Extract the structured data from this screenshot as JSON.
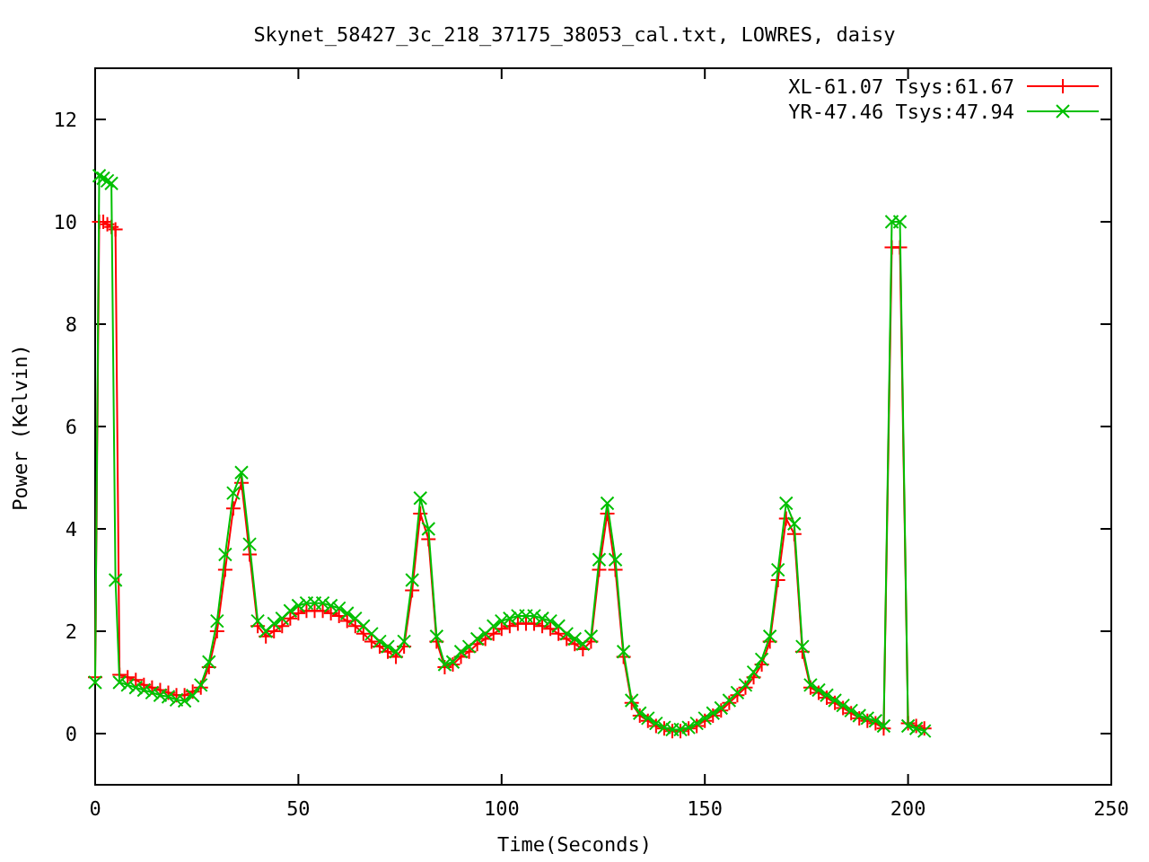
{
  "chart_data": {
    "type": "line",
    "title": "Skynet_58427_3c_218_37175_38053_cal.txt, LOWRES, daisy",
    "xlabel": "Time(Seconds)",
    "ylabel": "Power (Kelvin)",
    "xlim": [
      0,
      250
    ],
    "ylim": [
      -1,
      13
    ],
    "xticks": [
      0,
      50,
      100,
      150,
      200,
      250
    ],
    "yticks": [
      0,
      2,
      4,
      6,
      8,
      10,
      12
    ],
    "legend": "top right",
    "x": [
      0,
      1,
      2,
      3,
      4,
      5,
      6,
      8,
      10,
      12,
      14,
      16,
      18,
      20,
      22,
      24,
      26,
      28,
      30,
      32,
      34,
      36,
      38,
      40,
      42,
      44,
      46,
      48,
      50,
      52,
      54,
      56,
      58,
      60,
      62,
      64,
      66,
      68,
      70,
      72,
      74,
      76,
      78,
      80,
      82,
      84,
      86,
      88,
      90,
      92,
      94,
      96,
      98,
      100,
      102,
      104,
      106,
      108,
      110,
      112,
      114,
      116,
      118,
      120,
      122,
      124,
      126,
      128,
      130,
      132,
      134,
      136,
      138,
      140,
      142,
      144,
      146,
      148,
      150,
      152,
      154,
      156,
      158,
      160,
      162,
      164,
      166,
      168,
      170,
      172,
      174,
      176,
      178,
      180,
      182,
      184,
      186,
      188,
      190,
      192,
      194,
      196,
      198,
      200,
      202,
      204
    ],
    "series": [
      {
        "name": "XL-61.07 Tsys:61.67",
        "color": "#ff0000",
        "marker": "plus",
        "values": [
          1.1,
          10.0,
          10.0,
          9.95,
          9.9,
          9.85,
          1.15,
          1.1,
          1.05,
          0.95,
          0.9,
          0.85,
          0.8,
          0.75,
          0.75,
          0.82,
          0.9,
          1.3,
          2.0,
          3.2,
          4.4,
          4.9,
          3.5,
          2.1,
          1.9,
          2.0,
          2.1,
          2.25,
          2.35,
          2.4,
          2.4,
          2.4,
          2.35,
          2.3,
          2.2,
          2.1,
          1.95,
          1.8,
          1.7,
          1.6,
          1.5,
          1.7,
          2.8,
          4.3,
          3.8,
          1.8,
          1.3,
          1.35,
          1.5,
          1.6,
          1.75,
          1.85,
          1.95,
          2.05,
          2.1,
          2.15,
          2.15,
          2.15,
          2.1,
          2.05,
          1.95,
          1.85,
          1.75,
          1.65,
          1.8,
          3.2,
          4.3,
          3.2,
          1.5,
          0.6,
          0.35,
          0.25,
          0.15,
          0.1,
          0.05,
          0.05,
          0.1,
          0.15,
          0.25,
          0.35,
          0.45,
          0.6,
          0.75,
          0.9,
          1.1,
          1.35,
          1.8,
          3.0,
          4.2,
          3.9,
          1.6,
          0.9,
          0.8,
          0.7,
          0.6,
          0.5,
          0.4,
          0.3,
          0.25,
          0.2,
          0.1,
          9.5,
          9.5,
          0.2,
          0.15,
          0.1
        ]
      },
      {
        "name": "YR-47.46 Tsys:47.94",
        "color": "#00c000",
        "marker": "cross",
        "values": [
          1.0,
          10.9,
          10.85,
          10.8,
          10.75,
          3.0,
          1.0,
          0.95,
          0.9,
          0.85,
          0.8,
          0.75,
          0.72,
          0.66,
          0.64,
          0.74,
          0.95,
          1.4,
          2.2,
          3.5,
          4.7,
          5.1,
          3.7,
          2.2,
          2.0,
          2.15,
          2.25,
          2.4,
          2.5,
          2.55,
          2.55,
          2.55,
          2.5,
          2.45,
          2.35,
          2.25,
          2.1,
          1.95,
          1.8,
          1.7,
          1.6,
          1.8,
          3.0,
          4.6,
          4.0,
          1.9,
          1.35,
          1.4,
          1.6,
          1.7,
          1.85,
          1.95,
          2.1,
          2.2,
          2.25,
          2.3,
          2.3,
          2.3,
          2.25,
          2.2,
          2.1,
          1.95,
          1.85,
          1.75,
          1.9,
          3.4,
          4.5,
          3.4,
          1.6,
          0.65,
          0.4,
          0.3,
          0.2,
          0.12,
          0.08,
          0.08,
          0.12,
          0.2,
          0.3,
          0.4,
          0.5,
          0.65,
          0.8,
          0.95,
          1.2,
          1.45,
          1.9,
          3.2,
          4.5,
          4.1,
          1.7,
          0.95,
          0.85,
          0.75,
          0.65,
          0.55,
          0.45,
          0.35,
          0.3,
          0.25,
          0.15,
          10.0,
          10.0,
          0.15,
          0.1,
          0.05
        ]
      }
    ]
  }
}
